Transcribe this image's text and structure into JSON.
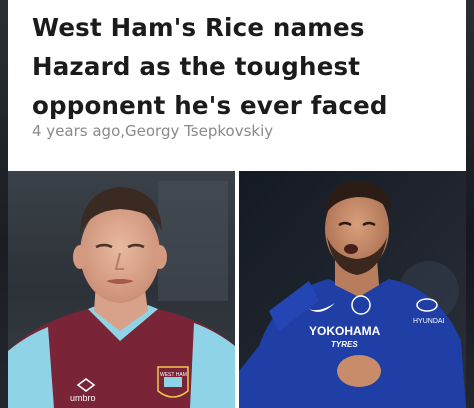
{
  "article": {
    "headline": "West Ham's Rice names Hazard as the toughest opponent he's ever faced",
    "meta": "4 years ago,Georgy Tsepkovskiy"
  },
  "photos": {
    "left": {
      "shirt_brand": "umbro",
      "crest_text": "WEST HAM"
    },
    "right": {
      "sponsor": "YOKOHAMA",
      "sponsor_sub": "TYRES",
      "sleeve": "HYUNDAI"
    }
  },
  "colors": {
    "headline": "#1b1b1b",
    "meta": "#8a8a8a",
    "claret": "#7a2438",
    "sky_blue": "#8fd3e6",
    "chelsea_blue": "#1f3fa6"
  }
}
